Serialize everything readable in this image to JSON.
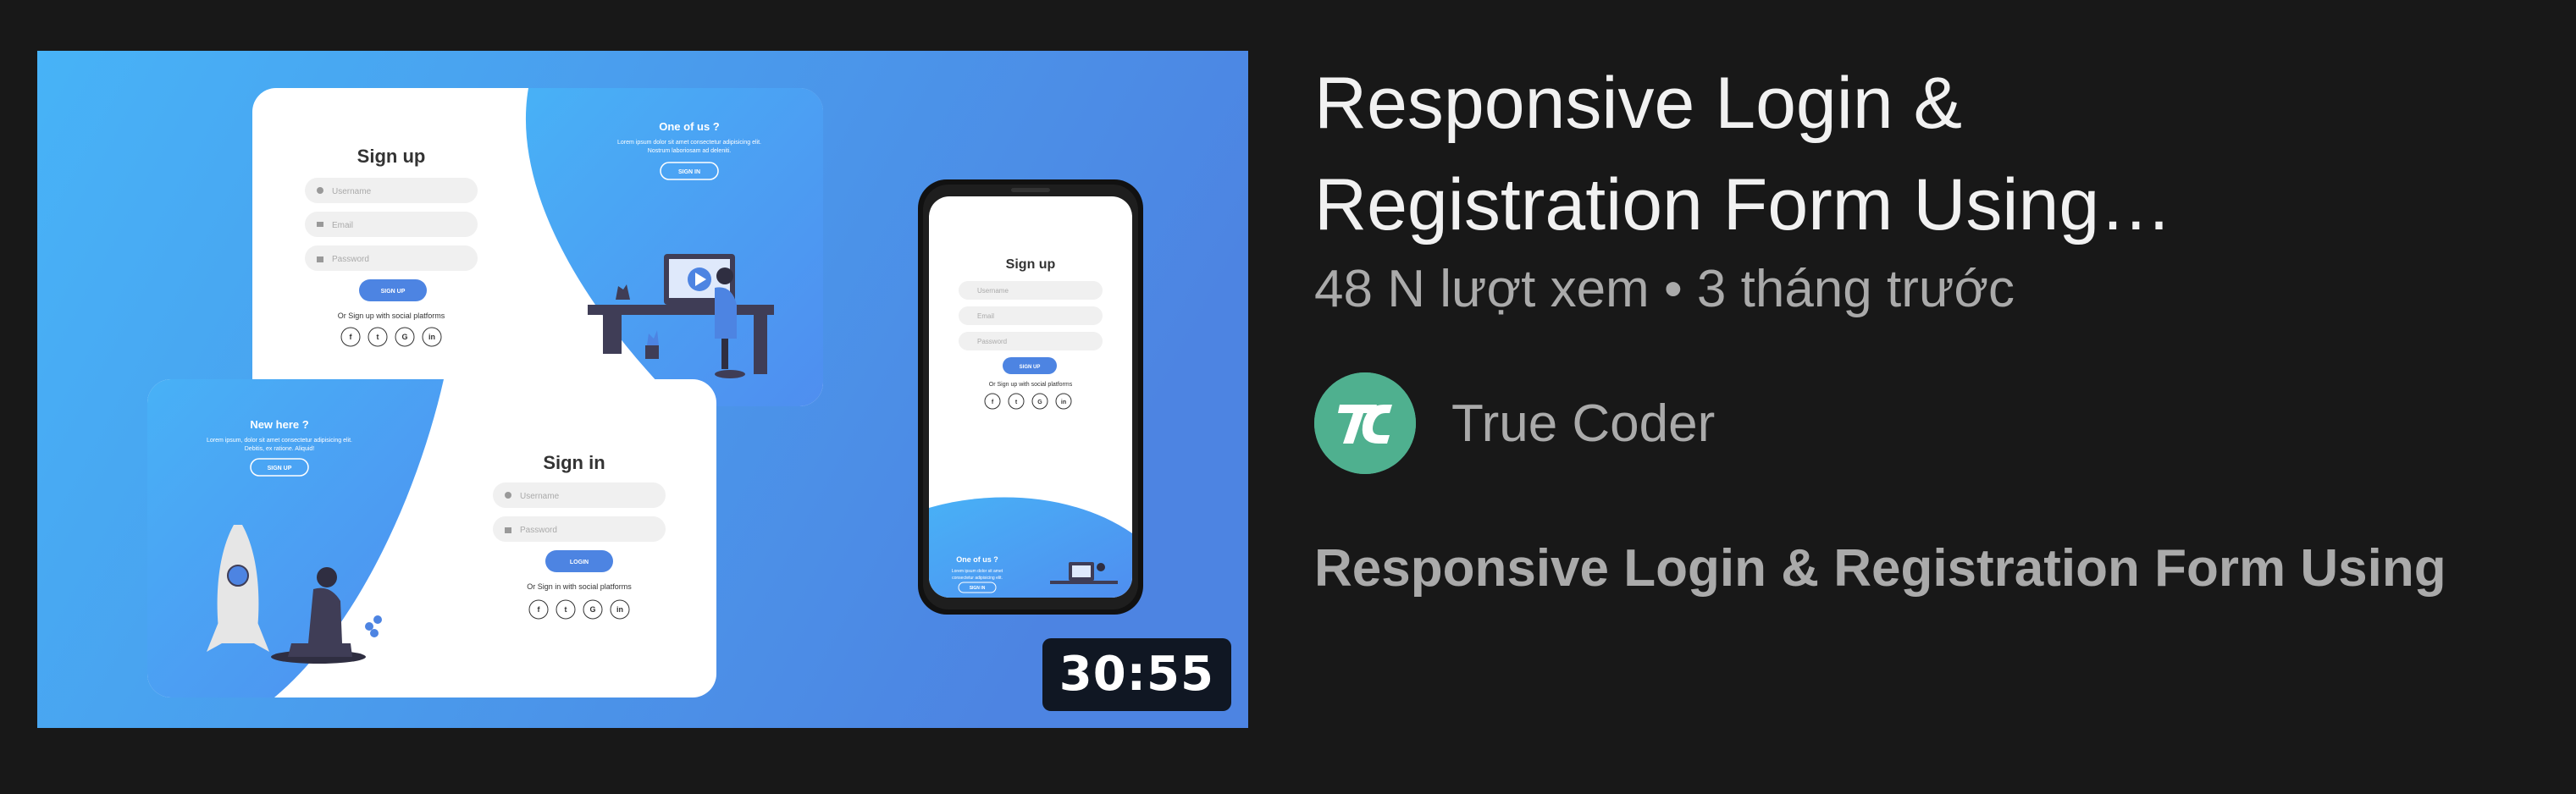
{
  "video": {
    "title": "Responsive Login & Registration Form Using…",
    "views": "48 N lượt xem",
    "separator": "•",
    "age": "3 tháng trước",
    "duration": "30:55",
    "description": "Responsive Login & Registration Form Using"
  },
  "channel": {
    "name": "True Coder",
    "avatar_initials": "TC",
    "avatar_color": "#4fb08f"
  },
  "thumbnail": {
    "signup_card": {
      "title": "Sign up",
      "username_placeholder": "Username",
      "email_placeholder": "Email",
      "password_placeholder": "Password",
      "button": "SIGN UP",
      "social_text": "Or Sign up with social platforms",
      "panel_heading": "One of us ?",
      "panel_text": "Lorem ipsum dolor sit amet consectetur adipisicing elit. Nostrum laboriosam ad deleniti.",
      "panel_button": "SIGN IN"
    },
    "signin_card": {
      "title": "Sign in",
      "username_placeholder": "Username",
      "password_placeholder": "Password",
      "button": "LOGIN",
      "social_text": "Or Sign in with social platforms",
      "panel_heading": "New here ?",
      "panel_text": "Lorem ipsum, dolor sit amet consectetur adipisicing elit. Debitis, ex ratione. Aliquid!",
      "panel_button": "SIGN UP"
    },
    "phone": {
      "title": "Sign up",
      "username_placeholder": "Username",
      "email_placeholder": "Email",
      "password_placeholder": "Password",
      "button": "SIGN UP",
      "social_text": "Or Sign up with social platforms",
      "panel_heading": "One of us ?",
      "panel_text": "Lorem ipsum dolor sit amet consectetur adipisicing elit.",
      "panel_button": "SIGN IN"
    },
    "social_icons": [
      "f",
      "t",
      "G",
      "in"
    ],
    "bg_color_start": "#47b3f7",
    "bg_color_end": "#4d84e2",
    "accent_color": "#4d84e2"
  }
}
